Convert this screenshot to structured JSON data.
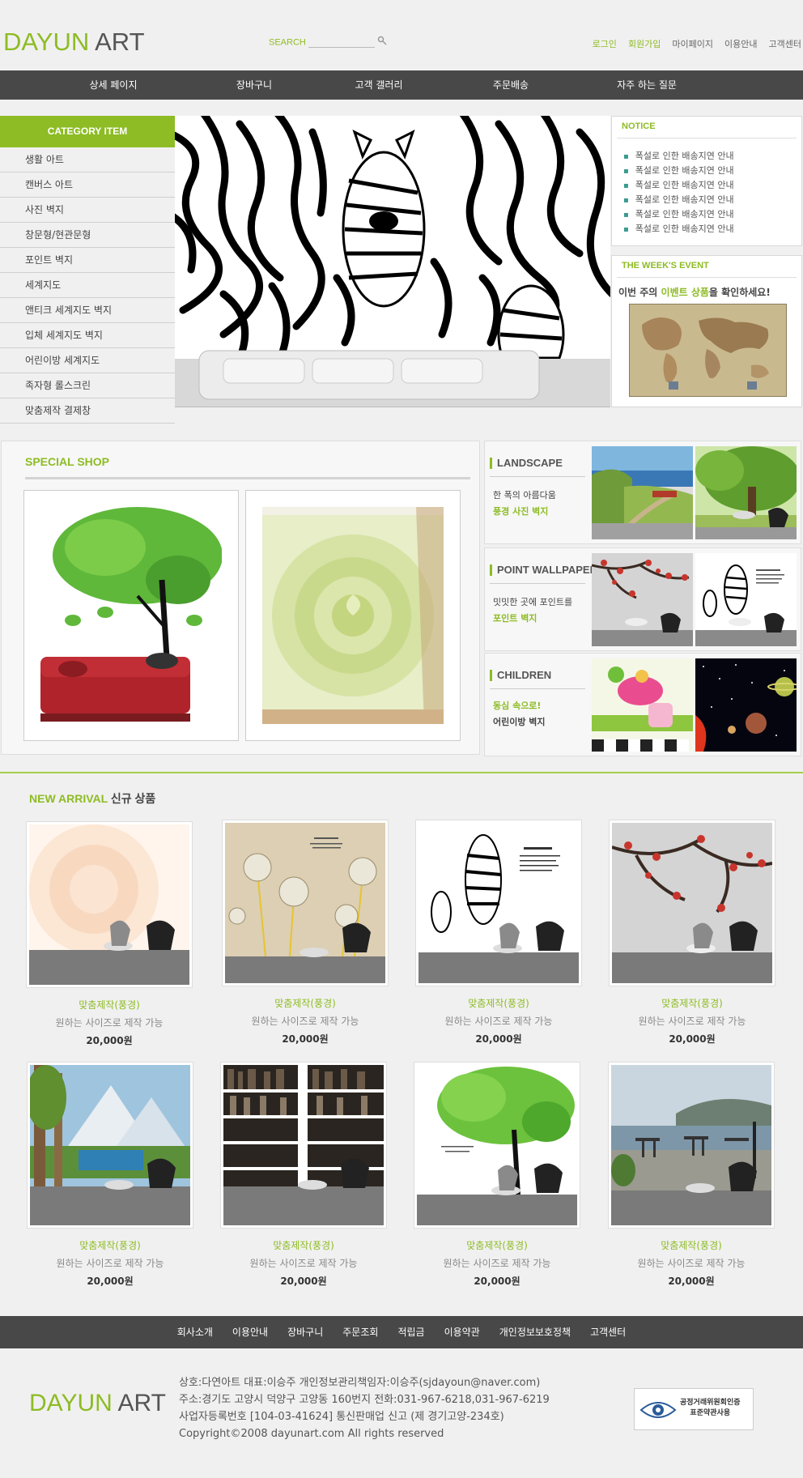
{
  "header": {
    "logo_green": "DAYUN",
    "logo_dark": "ART",
    "search_label": "SEARCH",
    "links": [
      "로그인",
      "회원가입",
      "마이페이지",
      "이용안내",
      "고객센터"
    ]
  },
  "nav": [
    "상세 페이지",
    "장바구니",
    "고객 갤러리",
    "주문배송",
    "자주 하는 질문"
  ],
  "category": {
    "title": "CATEGORY ITEM",
    "items": [
      "생활 아트",
      "캔버스 아트",
      "사진 벽지",
      "창문형/현관문형",
      "포인트 벽지",
      "세계지도",
      "앤티크 세계지도 벽지",
      "입체 세계지도 벽지",
      "어린이방 세계지도",
      "족자형 롤스크린",
      "맞춤제작 결제창"
    ]
  },
  "notice": {
    "title": "NOTICE",
    "items": [
      "폭설로 인한 배송지연 안내",
      "폭설로 인한 배송지연 안내",
      "폭설로 인한 배송지연 안내",
      "폭설로 인한 배송지연 안내",
      "폭설로 인한 배송지연 안내",
      "폭설로 인한 배송지연 안내"
    ]
  },
  "event": {
    "title": "THE WEEK'S EVENT",
    "text_pre": "이번 주의 ",
    "text_hl": "이벤트 상품",
    "text_post": "을 확인하세요!"
  },
  "special": {
    "title": "SPECIAL SHOP"
  },
  "right_categories": [
    {
      "title": "LANDSCAPE",
      "line1": "한 폭의 아름다움",
      "line2": "풍경 사진 벽지"
    },
    {
      "title": "POINT WALLPAPER",
      "line1": "밋밋한 곳에 포인트를",
      "line2": "포인트 벽지"
    },
    {
      "title": "CHILDREN",
      "line1": "동심 속으로!",
      "line2": "어린이방 벽지"
    }
  ],
  "new_arrival": {
    "title_green": "NEW ARRIVAL",
    "title_dark": " 신규 상품",
    "products": [
      {
        "name": "맞춤제작(풍경)",
        "desc": "원하는 사이즈로 제작 가능",
        "price": "20,000원"
      },
      {
        "name": "맞춤제작(풍경)",
        "desc": "원하는 사이즈로 제작 가능",
        "price": "20,000원"
      },
      {
        "name": "맞춤제작(풍경)",
        "desc": "원하는 사이즈로 제작 가능",
        "price": "20,000원"
      },
      {
        "name": "맞춤제작(풍경)",
        "desc": "원하는 사이즈로 제작 가능",
        "price": "20,000원"
      },
      {
        "name": "맞춤제작(풍경)",
        "desc": "원하는 사이즈로 제작 가능",
        "price": "20,000원"
      },
      {
        "name": "맞춤제작(풍경)",
        "desc": "원하는 사이즈로 제작 가능",
        "price": "20,000원"
      },
      {
        "name": "맞춤제작(풍경)",
        "desc": "원하는 사이즈로 제작 가능",
        "price": "20,000원"
      },
      {
        "name": "맞춤제작(풍경)",
        "desc": "원하는 사이즈로 제작 가능",
        "price": "20,000원"
      }
    ]
  },
  "footer": {
    "nav": [
      "회사소개",
      "이용안내",
      "장바구니",
      "주문조회",
      "적립금",
      "이용약관",
      "개인정보보호정책",
      "고객센터"
    ],
    "logo_green": "DAYUN",
    "logo_dark": "ART",
    "info": [
      "상호:다연아트  대표:이승주  개인정보관리책임자:이승주(sjdayoun@naver.com)",
      "주소:경기도 고양시 덕양구 고양동 160번지 전화:031-967-6218,031-967-6219",
      "사업자등록번호 [104-03-41624] 통신판매업 신고 (제 경기고양-234호)",
      "Copyright©2008 dayunart.com All rights reserved"
    ],
    "badge_line1": "공정거래위원회인증",
    "badge_line2": "표준약관사용"
  },
  "colors": {
    "accent": "#8dbc24",
    "nav_bg": "#484848",
    "page_bg": "#f1f0f0"
  }
}
